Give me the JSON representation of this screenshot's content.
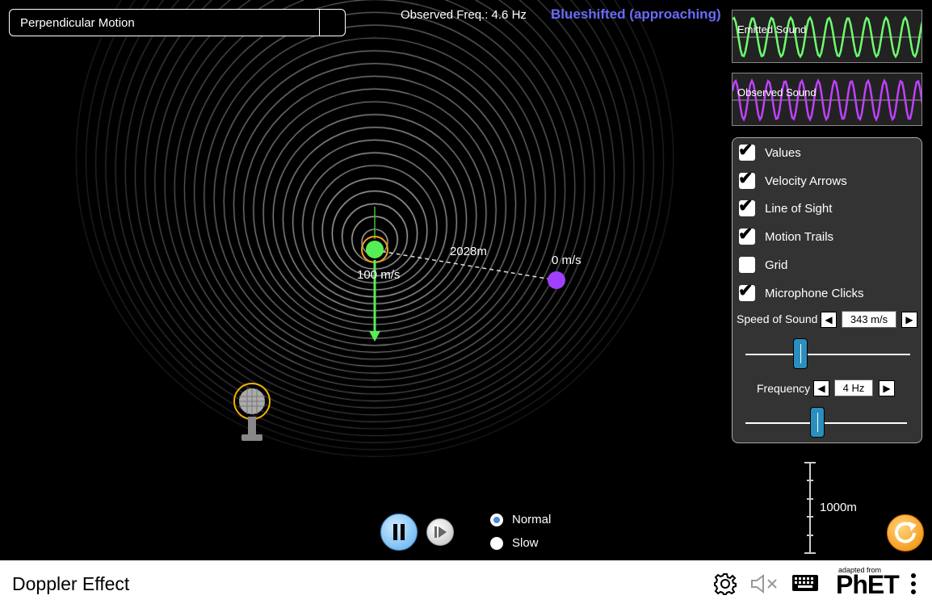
{
  "scenario": {
    "selected": "Perpendicular Motion"
  },
  "readout": {
    "observed_freq": "Observed Freq.: 4.6 Hz",
    "shift_status": "Blueshifted (approaching)",
    "shift_color": "#6b6bff"
  },
  "wave_panels": {
    "emitted_label": "Emitted Sound",
    "emitted_color": "#6dff6d",
    "observed_label": "Observed Sound",
    "observed_color": "#c040ff"
  },
  "scene": {
    "distance_label": "2028m",
    "source_speed": "100 m/s",
    "observer_speed": "0 m/s",
    "source_color": "#55ee55",
    "observer_color": "#a040ff"
  },
  "controls": {
    "checkboxes": [
      {
        "label": "Values",
        "checked": true
      },
      {
        "label": "Velocity Arrows",
        "checked": true
      },
      {
        "label": "Line of Sight",
        "checked": true
      },
      {
        "label": "Motion Trails",
        "checked": true
      },
      {
        "label": "Grid",
        "checked": false
      },
      {
        "label": "Microphone Clicks",
        "checked": true
      }
    ],
    "speed_of_sound": {
      "label": "Speed of Sound",
      "value": "343 m/s"
    },
    "frequency": {
      "label": "Frequency",
      "value": "4 Hz"
    }
  },
  "playback": {
    "normal_label": "Normal",
    "slow_label": "Slow",
    "selected": "Normal"
  },
  "scale": {
    "label": "1000m"
  },
  "navbar": {
    "title": "Doppler Effect",
    "adapted_from": "adapted from",
    "brand": "PhET"
  },
  "icons": {
    "settings": "gear-icon",
    "sound": "sound-muted-icon",
    "keyboard": "keyboard-icon",
    "menu": "kebab-menu-icon",
    "microphone": "microphone-icon",
    "reset": "reset-icon",
    "pause": "pause-icon",
    "step": "step-forward-icon"
  }
}
